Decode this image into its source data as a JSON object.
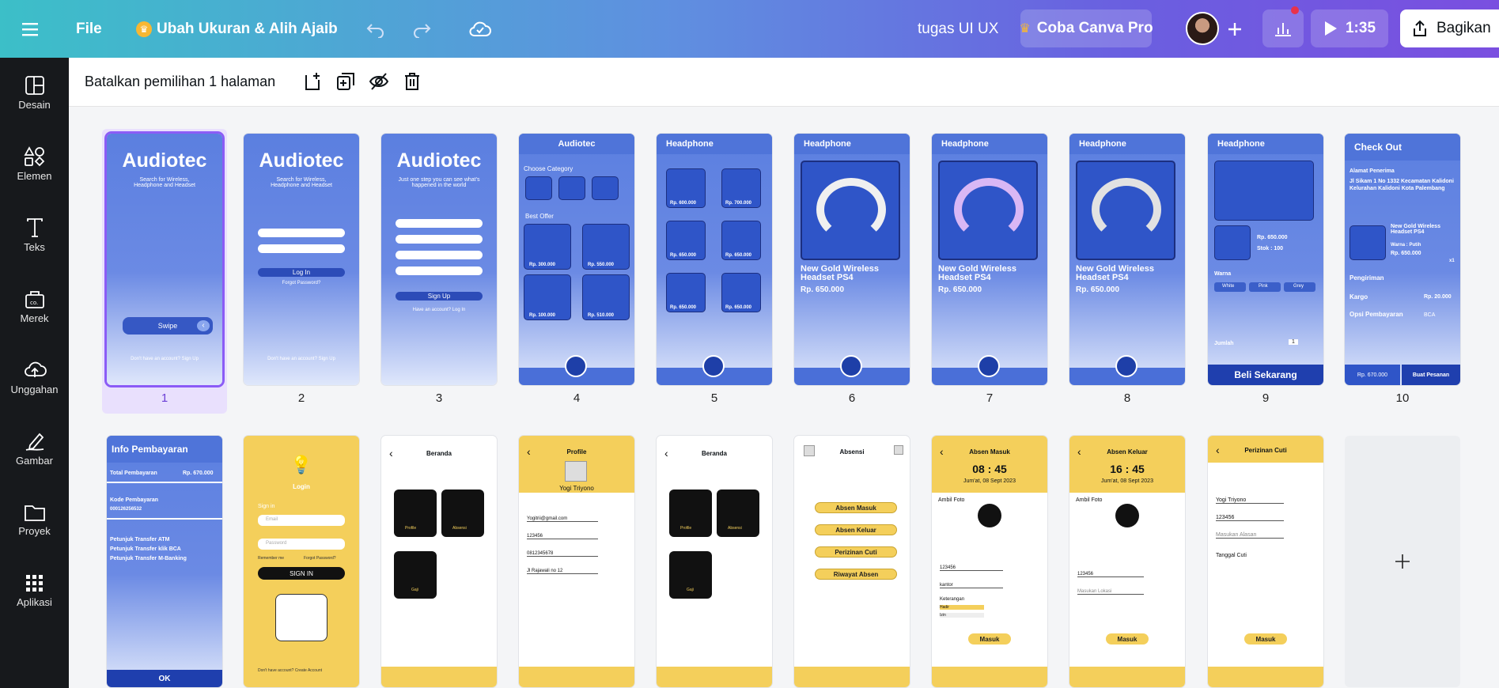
{
  "topbar": {
    "file_label": "File",
    "resize_label": "Ubah Ukuran & Alih Ajaib",
    "project_title": "tugas UI UX",
    "pro_label": "Coba Canva Pro",
    "timer": "1:35",
    "share_label": "Bagikan"
  },
  "sidebar": {
    "items": [
      {
        "label": "Desain",
        "icon": "layout-icon"
      },
      {
        "label": "Elemen",
        "icon": "shapes-icon"
      },
      {
        "label": "Teks",
        "icon": "text-icon"
      },
      {
        "label": "Merek",
        "icon": "brand-icon"
      },
      {
        "label": "Unggahan",
        "icon": "cloud-upload-icon"
      },
      {
        "label": "Gambar",
        "icon": "draw-icon"
      },
      {
        "label": "Proyek",
        "icon": "folder-icon"
      },
      {
        "label": "Aplikasi",
        "icon": "apps-grid-icon"
      }
    ]
  },
  "actionbar": {
    "deselect_label": "Batalkan pemilihan 1 halaman"
  },
  "pages": {
    "numbers": [
      "1",
      "2",
      "3",
      "4",
      "5",
      "6",
      "7",
      "8",
      "9",
      "10"
    ],
    "p1": {
      "brand": "Audiotec",
      "tagline": "Search for Wireless, Headphone and Headset",
      "swipe": "Swipe",
      "footer": "Don't have an account? Sign Up"
    },
    "p2": {
      "brand": "Audiotec",
      "tagline": "Search for Wireless, Headphone and Headset",
      "login": "Log In",
      "forgot": "Forgot Password?",
      "footer": "Don't have an account? Sign Up"
    },
    "p3": {
      "brand": "Audiotec",
      "tagline": "Just one step you can see what's happened in the world",
      "signup": "Sign Up",
      "have": "Have an account? Log In"
    },
    "p4": {
      "header": "Audiotec",
      "category": "Choose Category",
      "best": "Best Offer",
      "prices": [
        "Rp. 300.000",
        "Rp. 550.000",
        "Rp. 100.000",
        "Rp. 510.000"
      ]
    },
    "p5": {
      "header": "Headphone",
      "prices": [
        "Rp. 600.000",
        "Rp. 700.000",
        "Rp. 650.000",
        "Rp. 650.000",
        "Rp. 650.000",
        "Rp. 650.000"
      ]
    },
    "p6": {
      "header": "Headphone",
      "name": "New Gold Wireless Headset PS4",
      "price": "Rp. 650.000"
    },
    "p7": {
      "header": "Headphone",
      "name": "New Gold Wireless Headset PS4",
      "price": "Rp. 650.000"
    },
    "p8": {
      "header": "Headphone",
      "name": "New Gold Wireless Headset PS4",
      "price": "Rp. 650.000"
    },
    "p9": {
      "header": "Headphone",
      "price": "Rp. 650.000",
      "stock": "Stok : 100",
      "warna": "Warna",
      "colors": [
        "White",
        "Pink",
        "Grey"
      ],
      "jumlah": "Jumlah",
      "qty": "1",
      "buy": "Beli Sekarang"
    },
    "p10": {
      "header": "Check Out",
      "addr_label": "Alamat Penerima",
      "address": "Jl Sikam 1 No 1332 Kecamatan Kalidoni Kelurahan Kalidoni Kota Palembang",
      "item": "New Gold Wireless Headset PS4",
      "warna": "Warna : Putih",
      "price": "Rp. 650.000",
      "qty": "x1",
      "pengiriman": "Pengiriman",
      "kargo": "Kargo",
      "kargo_price": "Rp. 20.000",
      "opsi": "Opsi Pembayaran",
      "bca": "BCA",
      "total": "Rp. 670.000",
      "order": "Buat Pesanan"
    },
    "r2": {
      "info": {
        "header": "Info Pembayaran",
        "total_label": "Total Pembayaran",
        "total": "Rp. 670.000",
        "kode_label": "Kode Pembayaran",
        "kode": "000126256532",
        "atm": "Petunjuk Transfer ATM",
        "klik": "Petunjuk Transfer klik BCA",
        "mbanking": "Petunjuk Transfer M-Banking",
        "ok": "OK"
      },
      "login": {
        "title": "Login",
        "signin": "Sign in",
        "email": "Email",
        "password": "Password",
        "remember": "Remember me",
        "forgot": "Forgot Password?",
        "btn": "SIGN IN",
        "footer": "Don't have account? Create Account"
      },
      "beranda1": {
        "title": "Beranda",
        "profile": "Profile",
        "absensi": "Absensi",
        "gaji": "Gaji"
      },
      "profile": {
        "title": "Profile",
        "name": "Yogi Triyono",
        "email": "Yogitrii@gmail.com",
        "nip": "123456",
        "phone": "0812345678",
        "alamat": "Jl Rajawali no 12"
      },
      "beranda2": {
        "title": "Beranda",
        "profile": "Profile",
        "absensi": "Absensi",
        "gaji": "Gaji"
      },
      "absensi": {
        "title": "Absensi",
        "items": [
          "Absen Masuk",
          "Absen Keluar",
          "Perizinan Cuti",
          "Riwayat Absen"
        ]
      },
      "masuk": {
        "title": "Absen Masuk",
        "time": "08 : 45",
        "date": "Jum'at, 08 Sept 2023",
        "foto": "Ambil Foto",
        "nip": "123456",
        "lokasi": "kantor",
        "ket": "Keterangan",
        "opt1": "Hadir",
        "opt2": "Izin",
        "btn": "Masuk"
      },
      "keluar": {
        "title": "Absen Keluar",
        "time": "16 : 45",
        "date": "Jum'at, 08 Sept 2023",
        "foto": "Ambil Foto",
        "nip": "123456",
        "lokasi": "Masukan Lokasi",
        "btn": "Masuk"
      },
      "cuti": {
        "title": "Perizinan Cuti",
        "name": "Yogi Triyono",
        "nip": "123456",
        "alasan": "Masukan Alasan",
        "tanggal": "Tanggal Cuti",
        "btn": "Masuk"
      }
    }
  },
  "colors": {
    "canva_purple": "#8b5cf6",
    "app_blue": "#4f74d9",
    "app_yellow": "#f4cf5b"
  }
}
